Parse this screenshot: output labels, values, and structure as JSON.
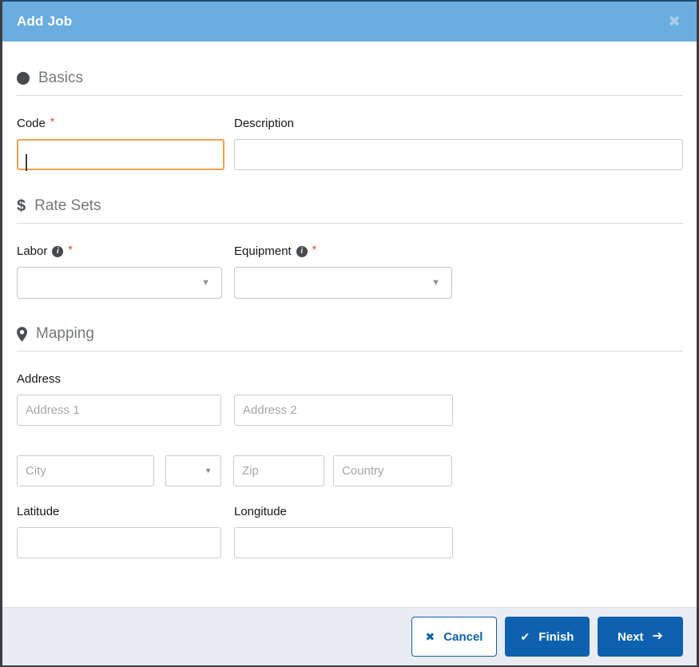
{
  "colors": {
    "header_bg": "#6badde",
    "primary_blue": "#0e61ae",
    "focus_orange": "#eda24c",
    "required_red": "#e03c31",
    "footer_bg": "#e9edf2"
  },
  "icons": {
    "close": "✖",
    "info": "i",
    "dollar": "$",
    "cancel": "✖",
    "check": "✔",
    "arrow_right": "➔",
    "caret_down": "▼"
  },
  "modal": {
    "title": "Add Job"
  },
  "sections": {
    "basics": {
      "title": "Basics"
    },
    "rate_sets": {
      "title": "Rate Sets"
    },
    "mapping": {
      "title": "Mapping"
    }
  },
  "fields": {
    "code": {
      "label": "Code",
      "required": "*",
      "value": ""
    },
    "description": {
      "label": "Description",
      "value": ""
    },
    "labor": {
      "label": "Labor",
      "required": "*",
      "value": ""
    },
    "equipment": {
      "label": "Equipment",
      "required": "*",
      "value": ""
    },
    "address": {
      "label": "Address"
    },
    "address1": {
      "placeholder": "Address 1",
      "value": ""
    },
    "address2": {
      "placeholder": "Address 2",
      "value": ""
    },
    "city": {
      "placeholder": "City",
      "value": ""
    },
    "state": {
      "value": ""
    },
    "zip": {
      "placeholder": "Zip",
      "value": ""
    },
    "country": {
      "placeholder": "Country",
      "value": ""
    },
    "latitude": {
      "label": "Latitude",
      "value": ""
    },
    "longitude": {
      "label": "Longitude",
      "value": ""
    }
  },
  "footer": {
    "cancel_label": "Cancel",
    "finish_label": "Finish",
    "next_label": "Next"
  }
}
